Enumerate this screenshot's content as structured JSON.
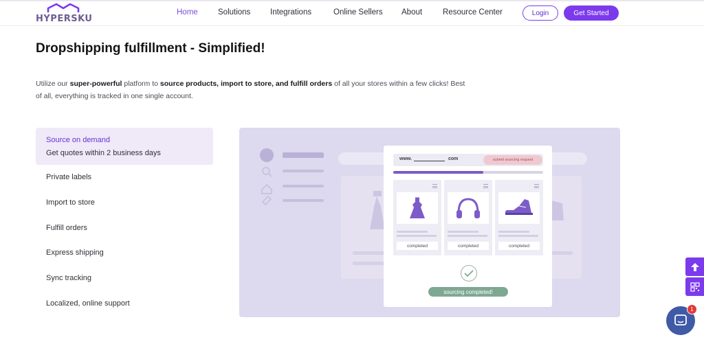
{
  "brand": {
    "name": "HYPERSKU",
    "color": "#7c3aed"
  },
  "nav": {
    "items": [
      "Home",
      "Solutions",
      "Integrations",
      "Online Sellers",
      "About",
      "Resource Center"
    ],
    "active_index": 0,
    "login_label": "Login",
    "get_started_label": "Get Started"
  },
  "hero": {
    "title": "Dropshipping fulfillment - Simplified!",
    "desc_1": "Utilize our ",
    "desc_bold_1": "super-powerful",
    "desc_2": " platform to ",
    "desc_bold_2": "source products, import to store, and fulfill orders",
    "desc_3": " of all your stores within a few clicks! Best of all, everything is tracked in one single account."
  },
  "features": {
    "active": {
      "title": "Source on demand",
      "subtitle": "Get quotes within 2 business days"
    },
    "items": [
      "Private labels",
      "Import to store",
      "Fulfill orders",
      "Express shipping",
      "Sync tracking",
      "Localized, online support"
    ]
  },
  "illustration": {
    "url_prefix": "www.",
    "url_suffix": "com",
    "submit_label": "submit sourcing request",
    "progress_fraction": 0.6,
    "products": [
      {
        "icon": "dress-icon",
        "status": "completed"
      },
      {
        "icon": "headphones-icon",
        "status": "completed"
      },
      {
        "icon": "sneaker-icon",
        "status": "completed"
      }
    ],
    "done_label": "sourcing completed!"
  },
  "widgets": {
    "chat_badge_count": "1"
  }
}
